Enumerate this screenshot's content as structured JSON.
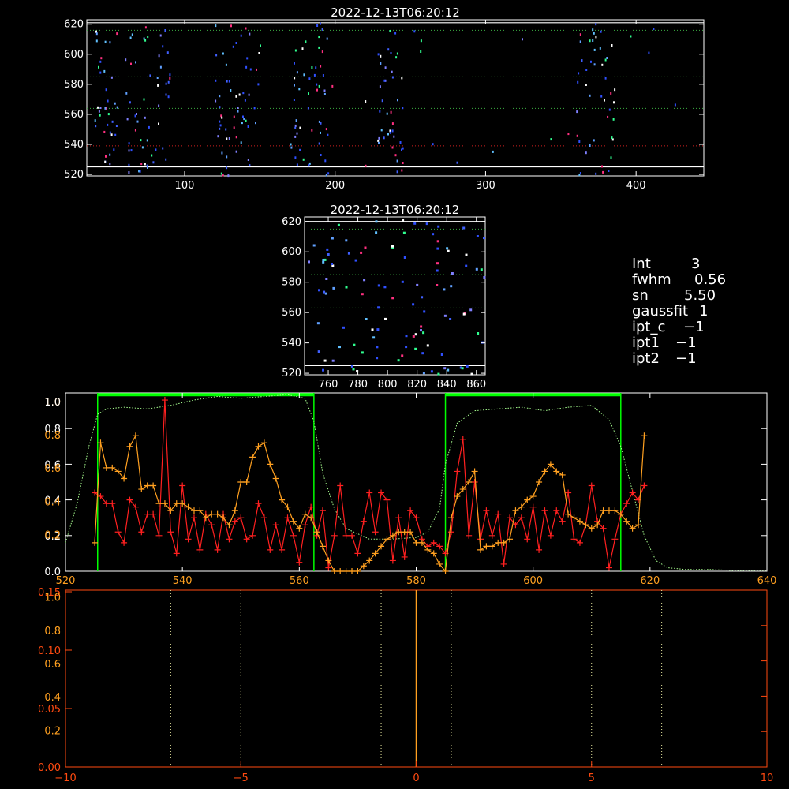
{
  "colors": {
    "background": "#000000",
    "axis_white": "#ffffff",
    "axis_orange": "#ff4a10",
    "series_red": "#ff2020",
    "series_orange": "#ffa020",
    "band_green": "#00ff00",
    "profile_green": "#a8ff90",
    "dot_dim": "#3050ff",
    "dot_bright": "#60a0ff"
  },
  "readout": {
    "int_label": "Int",
    "int_value": "3",
    "fwhm_label": "fwhm",
    "fwhm_value": "0.56",
    "sn_label": "sn",
    "sn_value": "5.50",
    "gaussfit_label": "gaussfit",
    "gaussfit_value": "1",
    "iptc_label": "ipt_c",
    "iptc_value": "−1",
    "ipt1_label": "ipt1",
    "ipt1_value": "−1",
    "ipt2_label": "ipt2",
    "ipt2_value": "−1"
  },
  "chart_data": [
    {
      "type": "scatter",
      "title": "2022-12-13T06:20:12",
      "xlim": [
        35,
        445
      ],
      "ylim": [
        519,
        623
      ],
      "x_ticks": [
        100,
        200,
        300,
        400
      ],
      "y_ticks": [
        520,
        540,
        560,
        580,
        600,
        620
      ],
      "hlines": [
        {
          "y": 621,
          "style": "solid"
        },
        {
          "y": 616,
          "style": "dotted"
        },
        {
          "y": 585,
          "style": "dotted"
        },
        {
          "y": 564,
          "style": "dotted"
        },
        {
          "y": 539,
          "style": "dotted-red"
        },
        {
          "y": 525,
          "style": "solid"
        }
      ],
      "clusters": [
        {
          "x": [
            40,
            55
          ],
          "n": 38
        },
        {
          "x": [
            60,
            90
          ],
          "n": 55
        },
        {
          "x": [
            120,
            150
          ],
          "n": 60
        },
        {
          "x": [
            170,
            195
          ],
          "n": 55
        },
        {
          "x": [
            228,
            245
          ],
          "n": 40
        },
        {
          "x": [
            360,
            385
          ],
          "n": 45
        },
        {
          "x": [
            195,
            430
          ],
          "n": 20
        }
      ]
    },
    {
      "type": "scatter",
      "title": "2022-12-13T06:20:12",
      "xlim": [
        744,
        866
      ],
      "ylim": [
        519,
        623
      ],
      "x_ticks": [
        760,
        780,
        800,
        820,
        840,
        860
      ],
      "y_ticks": [
        520,
        540,
        560,
        580,
        600,
        620
      ],
      "hlines": [
        {
          "y": 620,
          "style": "solid"
        },
        {
          "y": 615,
          "style": "dotted"
        },
        {
          "y": 585,
          "style": "dotted"
        },
        {
          "y": 563,
          "style": "dotted"
        },
        {
          "y": 525,
          "style": "solid"
        }
      ],
      "clusters": [
        {
          "x": [
            745,
            865
          ],
          "n": 110
        }
      ]
    },
    {
      "type": "line",
      "xlim": [
        520,
        640
      ],
      "ylim": [
        0,
        1.0
      ],
      "x_ticks": [
        520,
        540,
        560,
        580,
        600,
        620,
        640
      ],
      "y_ticks_left_white": [
        0.0,
        0.2,
        0.4,
        0.6,
        0.8
      ],
      "y_ticks_left_orange": [
        0.2,
        0.4,
        0.6,
        0.8,
        1.0
      ],
      "top_left_labels": [
        "1.0",
        "0.8"
      ],
      "bands": [
        {
          "x0": 525.5,
          "x1": 562.5
        },
        {
          "x0": 585,
          "x1": 615
        }
      ],
      "band_level": 0.99,
      "series": [
        {
          "role": "profile",
          "style": "dotted",
          "x": [
            520,
            522,
            524,
            525.5,
            527,
            530,
            534,
            538,
            542,
            546,
            550,
            554,
            558,
            561,
            562.5,
            564,
            566,
            568,
            572,
            576,
            580,
            582,
            584,
            585,
            587,
            590,
            594,
            598,
            602,
            606,
            610,
            613,
            615,
            617,
            619,
            621,
            623,
            626,
            630,
            634,
            638,
            640
          ],
          "y": [
            0.16,
            0.38,
            0.7,
            0.88,
            0.91,
            0.92,
            0.91,
            0.93,
            0.96,
            0.98,
            0.97,
            0.98,
            0.99,
            0.97,
            0.84,
            0.55,
            0.35,
            0.24,
            0.18,
            0.18,
            0.19,
            0.22,
            0.35,
            0.6,
            0.83,
            0.9,
            0.91,
            0.92,
            0.9,
            0.92,
            0.93,
            0.85,
            0.7,
            0.45,
            0.2,
            0.06,
            0.02,
            0.01,
            0.01,
            0.005,
            0.005,
            0.005
          ]
        },
        {
          "role": "red",
          "style": "plus",
          "x": [
            525,
            526,
            527,
            528,
            529,
            530,
            531,
            532,
            533,
            534,
            535,
            536,
            537,
            538,
            539,
            540,
            541,
            542,
            543,
            544,
            545,
            546,
            547,
            548,
            549,
            550,
            551,
            552,
            553,
            554,
            555,
            556,
            557,
            558,
            559,
            560,
            561,
            562,
            563,
            564,
            565,
            566,
            567,
            568,
            569,
            570,
            571,
            572,
            573,
            574,
            575,
            576,
            577,
            578,
            579,
            580,
            581,
            582,
            583,
            584,
            585,
            586,
            587,
            588,
            589,
            590,
            591,
            592,
            593,
            594,
            595,
            596,
            597,
            598,
            599,
            600,
            601,
            602,
            603,
            604,
            605,
            606,
            607,
            608,
            609,
            610,
            611,
            612,
            613,
            614,
            615,
            616,
            617,
            618,
            619
          ],
          "y": [
            0.44,
            0.42,
            0.38,
            0.38,
            0.22,
            0.16,
            0.4,
            0.36,
            0.22,
            0.32,
            0.32,
            0.2,
            0.96,
            0.22,
            0.1,
            0.48,
            0.18,
            0.3,
            0.12,
            0.32,
            0.26,
            0.12,
            0.32,
            0.18,
            0.28,
            0.3,
            0.18,
            0.2,
            0.38,
            0.3,
            0.12,
            0.26,
            0.12,
            0.3,
            0.2,
            0.05,
            0.26,
            0.36,
            0.2,
            0.34,
            0.02,
            0.2,
            0.48,
            0.2,
            0.2,
            0.1,
            0.28,
            0.44,
            0.22,
            0.44,
            0.4,
            0.06,
            0.3,
            0.08,
            0.34,
            0.3,
            0.18,
            0.14,
            0.16,
            0.14,
            0.1,
            0.22,
            0.56,
            0.74,
            0.2,
            0.5,
            0.18,
            0.34,
            0.2,
            0.32,
            0.04,
            0.3,
            0.26,
            0.3,
            0.18,
            0.36,
            0.12,
            0.34,
            0.2,
            0.34,
            0.28,
            0.44,
            0.18,
            0.16,
            0.26,
            0.48,
            0.28,
            0.24,
            0.02,
            0.18,
            0.32,
            0.38,
            0.44,
            0.4,
            0.48
          ]
        },
        {
          "role": "orange",
          "style": "plus",
          "x": [
            525,
            526,
            527,
            528,
            529,
            530,
            531,
            532,
            533,
            534,
            535,
            536,
            537,
            538,
            539,
            540,
            541,
            542,
            543,
            544,
            545,
            546,
            547,
            548,
            549,
            550,
            551,
            552,
            553,
            554,
            555,
            556,
            557,
            558,
            559,
            560,
            561,
            562,
            563,
            564,
            565,
            566,
            567,
            568,
            569,
            570,
            571,
            572,
            573,
            574,
            575,
            576,
            577,
            578,
            579,
            580,
            581,
            582,
            583,
            584,
            585,
            586,
            587,
            588,
            589,
            590,
            591,
            592,
            593,
            594,
            595,
            596,
            597,
            598,
            599,
            600,
            601,
            602,
            603,
            604,
            605,
            606,
            607,
            608,
            609,
            610,
            611,
            612,
            613,
            614,
            615,
            616,
            617,
            618,
            619
          ],
          "y": [
            0.16,
            0.72,
            0.58,
            0.58,
            0.56,
            0.52,
            0.7,
            0.76,
            0.46,
            0.48,
            0.48,
            0.38,
            0.38,
            0.34,
            0.38,
            0.38,
            0.36,
            0.34,
            0.34,
            0.3,
            0.32,
            0.32,
            0.3,
            0.26,
            0.34,
            0.5,
            0.5,
            0.64,
            0.7,
            0.72,
            0.6,
            0.52,
            0.4,
            0.36,
            0.28,
            0.24,
            0.32,
            0.3,
            0.22,
            0.14,
            0.06,
            0.0,
            0.0,
            0.0,
            0.0,
            0.0,
            0.03,
            0.06,
            0.1,
            0.14,
            0.18,
            0.2,
            0.22,
            0.22,
            0.22,
            0.16,
            0.16,
            0.12,
            0.1,
            0.04,
            0.0,
            0.3,
            0.42,
            0.46,
            0.5,
            0.56,
            0.12,
            0.14,
            0.14,
            0.16,
            0.16,
            0.18,
            0.34,
            0.36,
            0.4,
            0.42,
            0.5,
            0.56,
            0.6,
            0.56,
            0.54,
            0.32,
            0.3,
            0.28,
            0.26,
            0.24,
            0.26,
            0.34,
            0.34,
            0.34,
            0.32,
            0.28,
            0.24,
            0.26,
            0.76
          ]
        }
      ]
    },
    {
      "type": "line",
      "xlim": [
        -10,
        10
      ],
      "ylim": [
        0,
        1.0
      ],
      "x_ticks": [
        -10,
        -5,
        0,
        5,
        10
      ],
      "y_ticks_left_red": [
        "0.00",
        "0.05",
        "0.10",
        "0.15"
      ],
      "y_ticks_left_orange": [
        "0.2",
        "0.4",
        "0.6",
        "0.8",
        "1.0"
      ],
      "y_ticks_right_count": 6,
      "vlines_dotted_white": [
        -7,
        -5,
        -1,
        1,
        5,
        7
      ],
      "vline_center": 0
    }
  ]
}
